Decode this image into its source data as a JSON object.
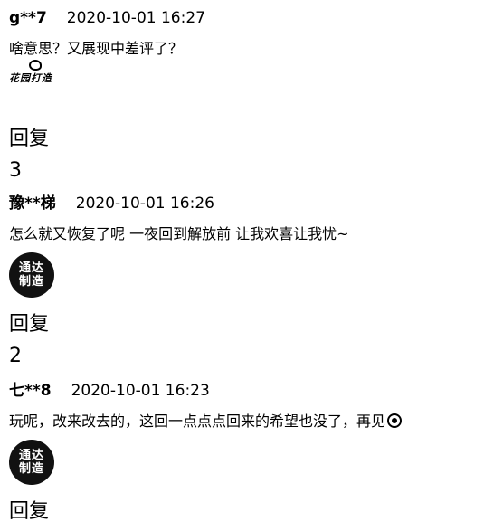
{
  "comments": [
    {
      "user": "g**7",
      "time": "2020-10-01 16:27",
      "text": "啥意思？又展现中差评了？",
      "badge": {
        "type": "logo",
        "lines": [
          "花园打造"
        ]
      },
      "reply_label": "回复",
      "count": "3"
    },
    {
      "user": "豫**梯",
      "time": "2020-10-01 16:26",
      "text": "怎么就又恢复了呢 一夜回到解放前 让我欢喜让我忧~",
      "badge": {
        "type": "circle",
        "lines": [
          "通达",
          "制造"
        ]
      },
      "reply_label": "回复",
      "count": "2"
    },
    {
      "user": "七**8",
      "time": "2020-10-01 16:23",
      "text": "玩呢，改来改去的，这回一点点点回来的希望也没了，再见",
      "badge": {
        "type": "circle",
        "lines": [
          "通达",
          "制造"
        ]
      },
      "reply_label": "回复",
      "count": ""
    }
  ]
}
